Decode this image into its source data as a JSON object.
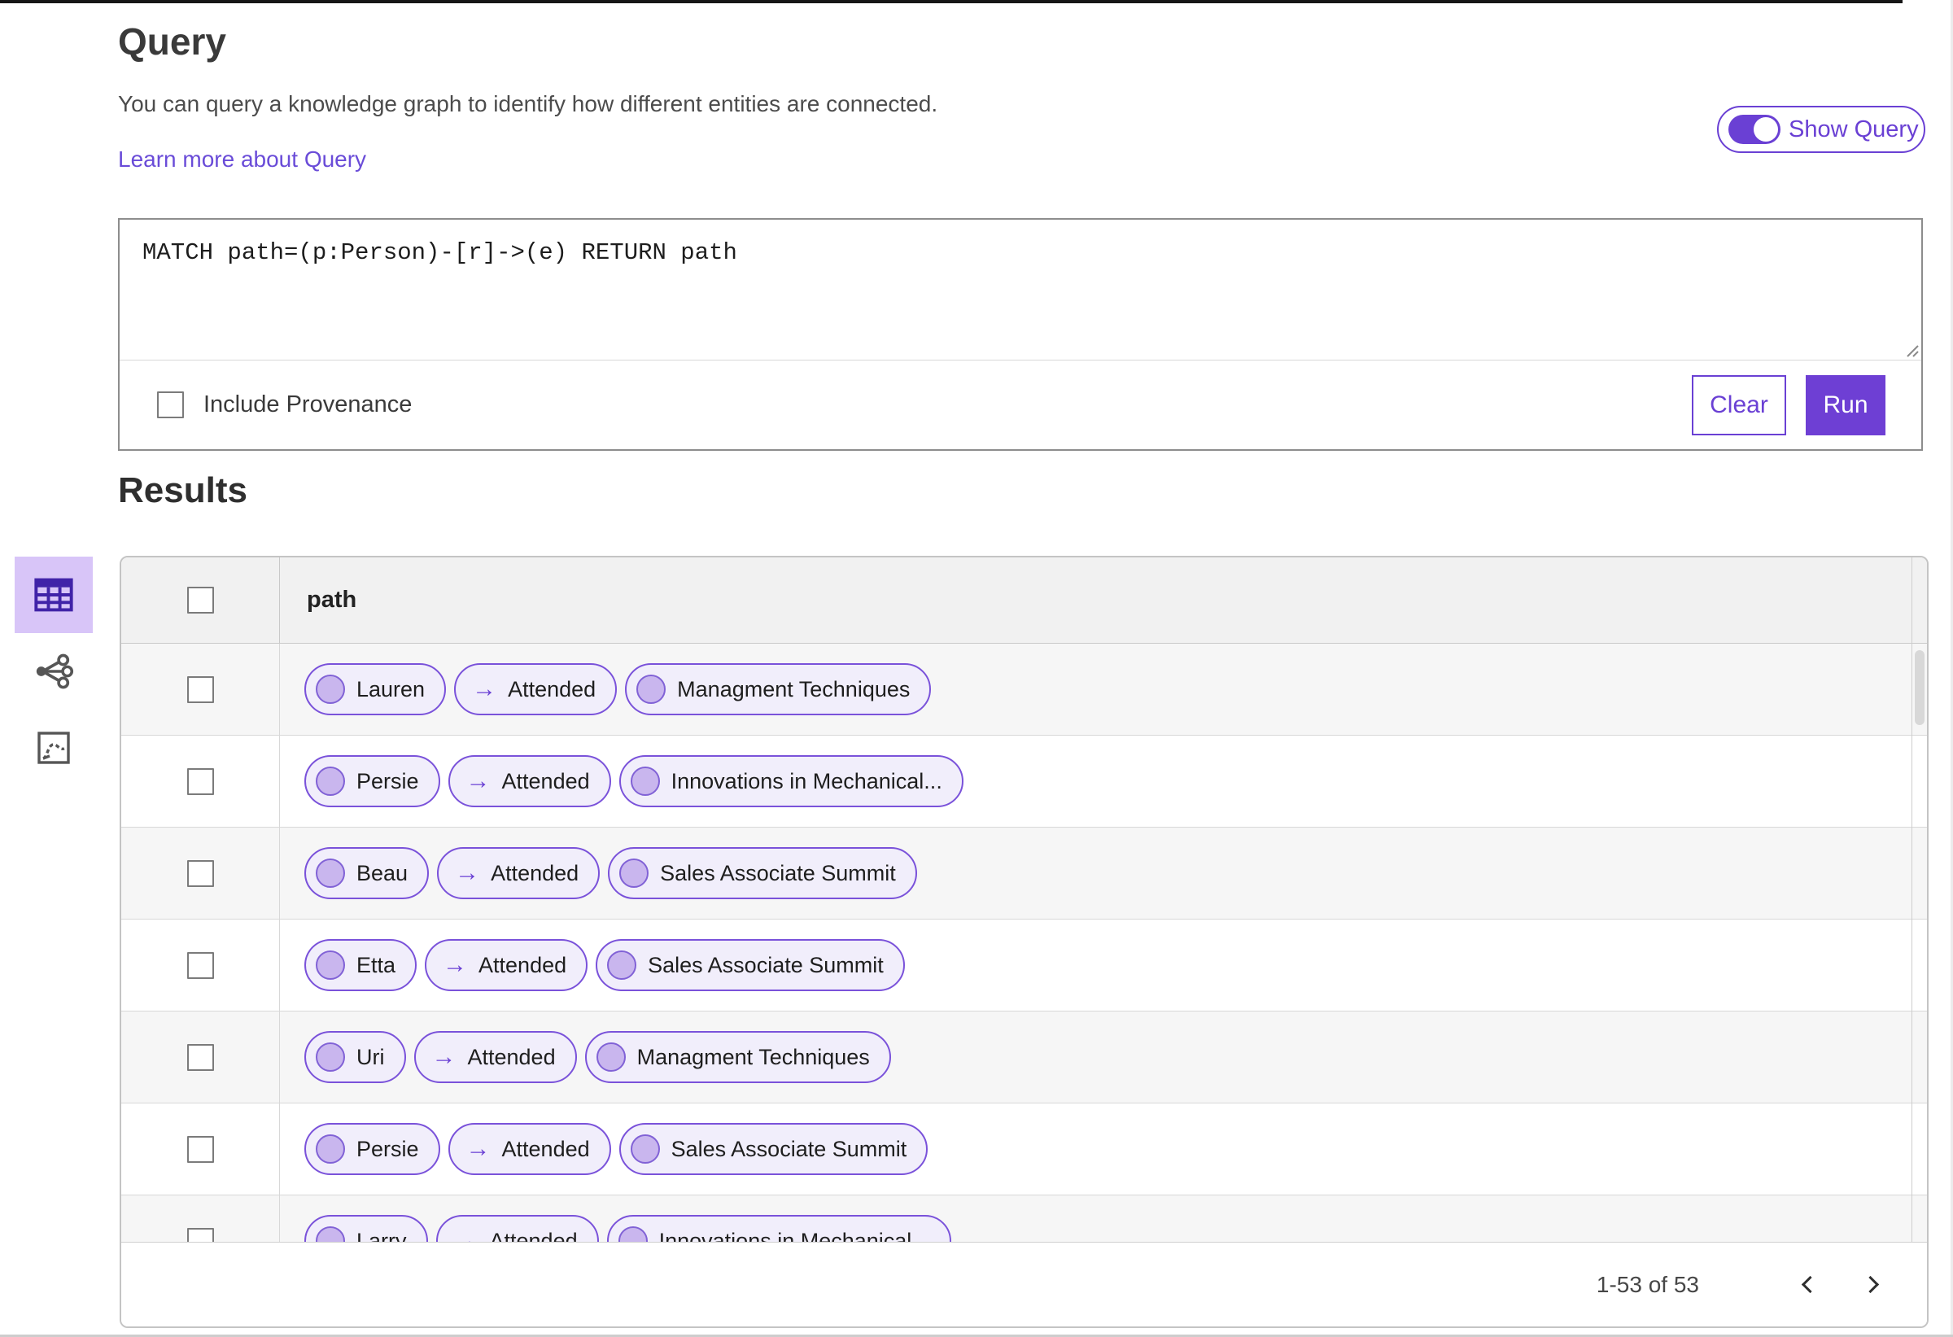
{
  "query_section": {
    "title": "Query",
    "description": "You can query a knowledge graph to identify how different entities are connected.",
    "learn_more_label": "Learn more about Query",
    "show_query_label": "Show Query",
    "show_query_toggle_on": true,
    "query_text": "MATCH path=(p:Person)-[r]->(e) RETURN path",
    "include_provenance_label": "Include Provenance",
    "include_provenance_checked": false,
    "clear_label": "Clear",
    "run_label": "Run"
  },
  "results_section": {
    "title": "Results",
    "view_switcher": {
      "tabs": [
        {
          "name": "table-view",
          "icon": "table-icon",
          "selected": true
        },
        {
          "name": "graph-view",
          "icon": "graph-icon",
          "selected": false
        },
        {
          "name": "chart-view",
          "icon": "chart-icon",
          "selected": false
        }
      ]
    },
    "chip_arrow_glyph": "→",
    "table": {
      "column_header": "path",
      "rows": [
        {
          "source": "Lauren",
          "edge": "Attended",
          "target": "Managment Techniques"
        },
        {
          "source": "Persie",
          "edge": "Attended",
          "target": "Innovations in Mechanical..."
        },
        {
          "source": "Beau",
          "edge": "Attended",
          "target": "Sales Associate Summit"
        },
        {
          "source": "Etta",
          "edge": "Attended",
          "target": "Sales Associate Summit"
        },
        {
          "source": "Uri",
          "edge": "Attended",
          "target": "Managment Techniques"
        },
        {
          "source": "Persie",
          "edge": "Attended",
          "target": "Sales Associate Summit"
        },
        {
          "source": "Larry",
          "edge": "Attended",
          "target": "Innovations in Mechanical..."
        }
      ]
    },
    "pagination": {
      "range_label": "1-53 of 53"
    }
  },
  "colors": {
    "accent_purple": "#6e3fd4",
    "chip_border": "#7a52da",
    "chip_background": "#f1eefb",
    "node_circle_fill": "#c9b6ee",
    "selected_tab_background": "#d8c5f8",
    "header_row_background": "#f1f1f1",
    "stripe_row_background": "#f6f6f6"
  }
}
